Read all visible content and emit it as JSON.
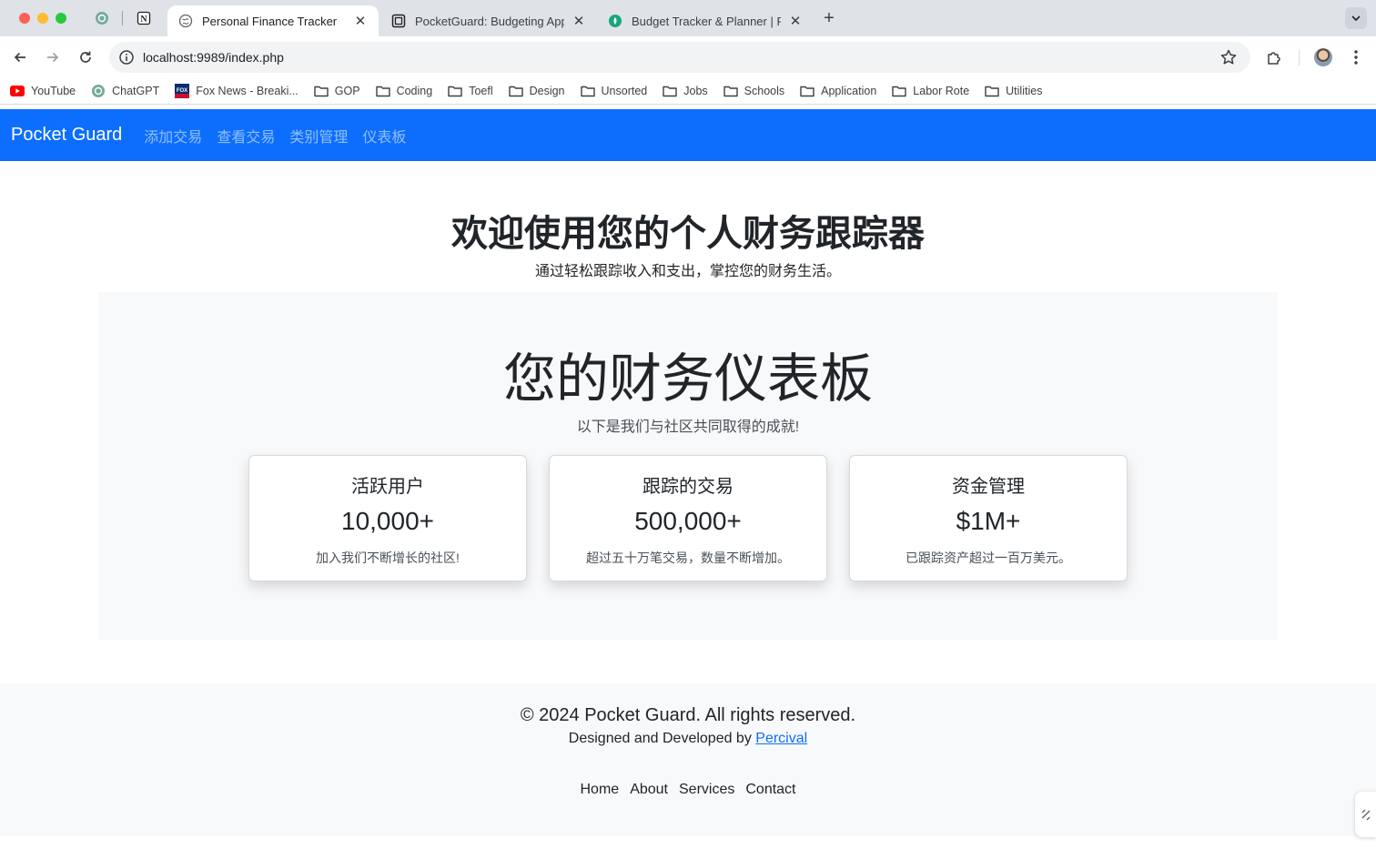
{
  "browser": {
    "tabs": [
      {
        "title": "Personal Finance Tracker",
        "active": true
      },
      {
        "title": "PocketGuard: Budgeting App",
        "active": false
      },
      {
        "title": "Budget Tracker & Planner | Fr",
        "active": false
      }
    ],
    "url": "localhost:9989/index.php",
    "bookmarks": [
      {
        "label": "YouTube",
        "icon": "youtube-icon"
      },
      {
        "label": "ChatGPT",
        "icon": "chatgpt-icon"
      },
      {
        "label": "Fox News - Breaki...",
        "icon": "foxnews-icon"
      },
      {
        "label": "GOP",
        "icon": "folder-icon"
      },
      {
        "label": "Coding",
        "icon": "folder-icon"
      },
      {
        "label": "Toefl",
        "icon": "folder-icon"
      },
      {
        "label": "Design",
        "icon": "folder-icon"
      },
      {
        "label": "Unsorted",
        "icon": "folder-icon"
      },
      {
        "label": "Jobs",
        "icon": "folder-icon"
      },
      {
        "label": "Schools",
        "icon": "folder-icon"
      },
      {
        "label": "Application",
        "icon": "folder-icon"
      },
      {
        "label": "Labor Rote",
        "icon": "folder-icon"
      },
      {
        "label": "Utilities",
        "icon": "folder-icon"
      }
    ]
  },
  "navbar": {
    "brand": "Pocket Guard",
    "links": [
      "添加交易",
      "查看交易",
      "类别管理",
      "仪表板"
    ]
  },
  "hero": {
    "title": "欢迎使用您的个人财务跟踪器",
    "subtitle": "通过轻松跟踪收入和支出，掌控您的财务生活。"
  },
  "dashboard": {
    "title": "您的财务仪表板",
    "subtitle": "以下是我们与社区共同取得的成就!",
    "cards": [
      {
        "title": "活跃用户",
        "value": "10,000+",
        "text": "加入我们不断增长的社区!"
      },
      {
        "title": "跟踪的交易",
        "value": "500,000+",
        "text": "超过五十万笔交易，数量不断增加。"
      },
      {
        "title": "资金管理",
        "value": "$1M+",
        "text": "已跟踪资产超过一百万美元。"
      }
    ]
  },
  "footer": {
    "copyright": "© 2024 Pocket Guard. All rights reserved.",
    "credit_prefix": "Designed and Developed by ",
    "credit_link": "Percival",
    "links": [
      "Home",
      "About",
      "Services",
      "Contact"
    ]
  },
  "colors": {
    "navbar": "#0d6efd",
    "link": "#0d6efd",
    "panel": "#f8f9fa"
  }
}
